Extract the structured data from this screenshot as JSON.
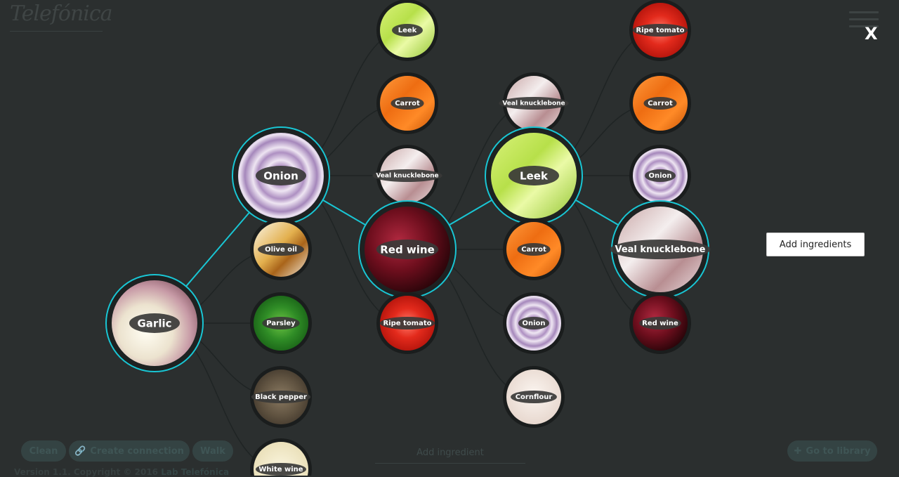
{
  "app": {
    "logo_text": "Telefónica",
    "close_label": "X",
    "add_ingredients_label": "Add ingredients"
  },
  "toolbar": {
    "clean_label": "Clean",
    "create_connection_label": "Create connection",
    "walk_label": "Walk",
    "add_ingredient_placeholder": "Add ingredient",
    "go_to_library_label": "Go to library",
    "version_text": "Version 1.1. Copyright © 2016",
    "version_link_text": "Lab Telefónica"
  },
  "colors": {
    "background": "#2b2f2f",
    "highlight_ring": "#19c6d4",
    "connector": "#1f2424"
  },
  "graph": {
    "nodes": [
      {
        "id": "garlic",
        "label": "Garlic",
        "texture": "garlic",
        "highlighted": true
      },
      {
        "id": "onion1",
        "label": "Onion",
        "texture": "onion",
        "highlighted": true
      },
      {
        "id": "oliveoil",
        "label": "Olive oil",
        "texture": "oliveoil",
        "highlighted": false
      },
      {
        "id": "parsley",
        "label": "Parsley",
        "texture": "parsley",
        "highlighted": false
      },
      {
        "id": "blackpepper",
        "label": "Black pepper",
        "texture": "pepper",
        "highlighted": false
      },
      {
        "id": "whitewine",
        "label": "White wine",
        "texture": "whitewine",
        "highlighted": false
      },
      {
        "id": "leek1",
        "label": "Leek",
        "texture": "leek",
        "highlighted": false
      },
      {
        "id": "carrot1",
        "label": "Carrot",
        "texture": "carrot",
        "highlighted": false
      },
      {
        "id": "veal1",
        "label": "Veal knucklebone",
        "texture": "veal",
        "highlighted": false
      },
      {
        "id": "redwine1",
        "label": "Red wine",
        "texture": "redwine",
        "highlighted": true
      },
      {
        "id": "tomato1",
        "label": "Ripe tomato",
        "texture": "tomato",
        "highlighted": false
      },
      {
        "id": "veal2",
        "label": "Veal knucklebone",
        "texture": "veal",
        "highlighted": false
      },
      {
        "id": "leek2",
        "label": "Leek",
        "texture": "leek",
        "highlighted": true
      },
      {
        "id": "carrot2",
        "label": "Carrot",
        "texture": "carrot",
        "highlighted": false
      },
      {
        "id": "onion2",
        "label": "Onion",
        "texture": "onion",
        "highlighted": false
      },
      {
        "id": "cornflour",
        "label": "Cornflour",
        "texture": "cornflour",
        "highlighted": false
      },
      {
        "id": "tomato2",
        "label": "Ripe tomato",
        "texture": "tomato",
        "highlighted": false
      },
      {
        "id": "carrot3",
        "label": "Carrot",
        "texture": "carrot",
        "highlighted": false
      },
      {
        "id": "onion3",
        "label": "Onion",
        "texture": "onion",
        "highlighted": false
      },
      {
        "id": "veal3",
        "label": "Veal knucklebone",
        "texture": "veal",
        "highlighted": true
      },
      {
        "id": "redwine2",
        "label": "Red wine",
        "texture": "redwine",
        "highlighted": false
      }
    ],
    "edges": [
      {
        "from": "garlic",
        "to": "onion1",
        "highlighted": true
      },
      {
        "from": "garlic",
        "to": "oliveoil",
        "highlighted": false
      },
      {
        "from": "garlic",
        "to": "parsley",
        "highlighted": false
      },
      {
        "from": "garlic",
        "to": "blackpepper",
        "highlighted": false
      },
      {
        "from": "garlic",
        "to": "whitewine",
        "highlighted": false
      },
      {
        "from": "onion1",
        "to": "leek1",
        "highlighted": false
      },
      {
        "from": "onion1",
        "to": "carrot1",
        "highlighted": false
      },
      {
        "from": "onion1",
        "to": "veal1",
        "highlighted": false
      },
      {
        "from": "onion1",
        "to": "redwine1",
        "highlighted": true
      },
      {
        "from": "onion1",
        "to": "tomato1",
        "highlighted": false
      },
      {
        "from": "redwine1",
        "to": "veal2",
        "highlighted": false
      },
      {
        "from": "redwine1",
        "to": "leek2",
        "highlighted": true
      },
      {
        "from": "redwine1",
        "to": "carrot2",
        "highlighted": false
      },
      {
        "from": "redwine1",
        "to": "onion2",
        "highlighted": false
      },
      {
        "from": "redwine1",
        "to": "cornflour",
        "highlighted": false
      },
      {
        "from": "leek2",
        "to": "tomato2",
        "highlighted": false
      },
      {
        "from": "leek2",
        "to": "carrot3",
        "highlighted": false
      },
      {
        "from": "leek2",
        "to": "onion3",
        "highlighted": false
      },
      {
        "from": "leek2",
        "to": "veal3",
        "highlighted": true
      },
      {
        "from": "leek2",
        "to": "redwine2",
        "highlighted": false
      }
    ]
  }
}
